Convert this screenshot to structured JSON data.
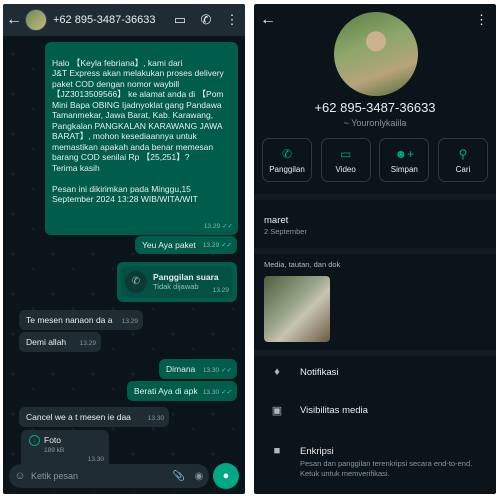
{
  "chat": {
    "contact": "+62 895-3487-36633",
    "messages": {
      "big": "Halo 【Keyla febriana】, kami dari\nJ&T Express akan melakukan proses delivery paket COD dengan nomor waybill 【JZ3013509566】 ke alamat anda di 【Pom Mini Bapa OBING Ijadnyoklat gang Pandawa Tamanmekar, Jawa Barat, Kab. Karawang, Pangkalan PANGKALAN KARAWANG JAWA BARAT】, mohon kesediaannya untuk memastikan apakah anda benar memesan barang COD senilai Rp 【25,251】?\nTerima kasih\n\nPesan ini dikirimkan pada Minggu,15 September 2024 13:28 WIB/WITA/WIT",
      "big_time": "13.29",
      "m1": "Yeu Aya paket",
      "m1_time": "13.29",
      "call_title": "Panggilan suara",
      "call_sub": "Tidak dijawab",
      "call_time": "13.29",
      "m2": "Te mesen nanaon da a",
      "m2_time": "13.29",
      "m3": "Demi allah",
      "m3_time": "13.29",
      "m4": "Dimana",
      "m4_time": "13.30",
      "m5": "Berati Aya di apk",
      "m5_time": "13.30",
      "m6": "Cancel we a t mesen ie daa",
      "m6_time": "13.30",
      "foto_name": "Foto",
      "foto_size": "189 kB",
      "foto_time": "13.30"
    },
    "input_placeholder": "Ketik pesan"
  },
  "info": {
    "phone": "+62 895-3487-36633",
    "about": "~ Youronlykaiila",
    "actions": [
      "Panggilan",
      "Video",
      "Simpan",
      "Cari"
    ],
    "status_text": "maret",
    "status_date": "2 September",
    "media_label": "Media, tautan, dan dok",
    "notif": "Notifikasi",
    "visibility": "Visibilitas media",
    "enc_title": "Enkripsi",
    "enc_desc": "Pesan dan panggilan terenkripsi secara end-to-end. Ketuk untuk memverifikasi."
  },
  "colors": {
    "accent": "#00a884",
    "outgoing": "#005c4b",
    "incoming": "#202c33",
    "bg": "#0b141a"
  },
  "icons": [
    "back-arrow-icon",
    "video-icon",
    "phone-icon",
    "more-icon",
    "emoji-icon",
    "attach-icon",
    "camera-icon",
    "mic-icon",
    "bell-icon",
    "image-icon",
    "lock-icon",
    "user-add-icon",
    "search-icon"
  ]
}
